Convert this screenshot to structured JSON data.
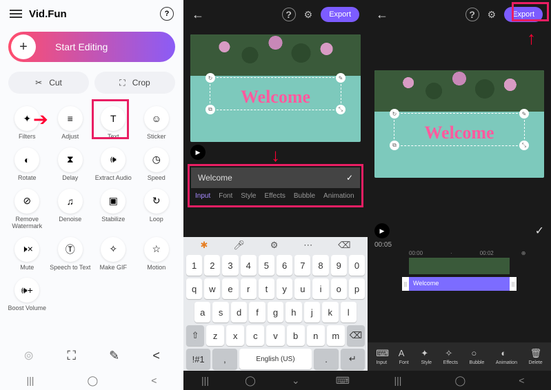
{
  "p1": {
    "brand": "Vid.Fun",
    "start": "Start Editing",
    "cut": "Cut",
    "crop": "Crop",
    "tools": [
      "Filters",
      "Adjust",
      "Text",
      "Sticker",
      "Rotate",
      "Delay",
      "Extract Audio",
      "Speed",
      "Remove Watermark",
      "Denoise",
      "Stabilize",
      "Loop",
      "Mute",
      "Speech to Text",
      "Make GIF",
      "Motion",
      "Boost Volume"
    ]
  },
  "p2": {
    "export": "Export",
    "welcome": "Welcome",
    "input_val": "Welcome",
    "tabs": [
      "Input",
      "Font",
      "Style",
      "Effects",
      "Bubble",
      "Animation"
    ],
    "kb_lang": "English (US)",
    "kb_sym": "!#1"
  },
  "p3": {
    "export": "Export",
    "welcome": "Welcome",
    "time": "00:05",
    "ruler": [
      "00:00",
      "00:02"
    ],
    "clip_label": "Welcome",
    "tools": [
      "Input",
      "Font",
      "Style",
      "Effects",
      "Bubble",
      "Animation",
      "Delete"
    ]
  }
}
